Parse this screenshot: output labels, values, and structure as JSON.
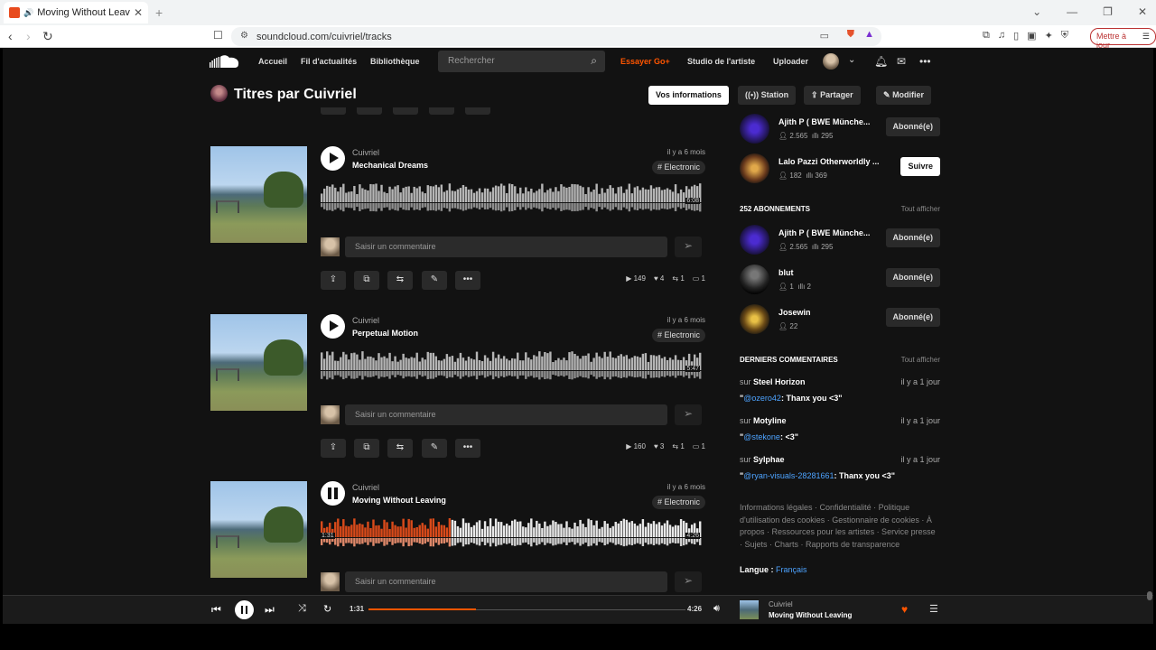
{
  "browser": {
    "tab_title": "Moving Without Leaving par",
    "url": "soundcloud.com/cuivriel/tracks",
    "update_label": "Mettre à jour"
  },
  "header": {
    "nav": [
      "Accueil",
      "Fil d'actualités",
      "Bibliothèque"
    ],
    "search_placeholder": "Rechercher",
    "go_label": "Essayer Go+",
    "studio_label": "Studio de l'artiste",
    "upload_label": "Uploader"
  },
  "title_bar": {
    "title": "Titres par Cuivriel",
    "buttons": {
      "info": "Vos informations",
      "station": "Station",
      "share": "Partager",
      "edit": "Modifier"
    }
  },
  "tracks": [
    {
      "artist": "Cuivriel",
      "title": "Mechanical Dreams",
      "ago": "il y a 6 mois",
      "tag": "# Electronic",
      "duration": "6:08",
      "comment_placeholder": "Saisir un commentaire",
      "plays": "149",
      "likes": "4",
      "reposts": "1",
      "comments": "1",
      "playing": false
    },
    {
      "artist": "Cuivriel",
      "title": "Perpetual Motion",
      "ago": "il y a 6 mois",
      "tag": "# Electronic",
      "duration": "5:47",
      "comment_placeholder": "Saisir un commentaire",
      "plays": "160",
      "likes": "3",
      "reposts": "1",
      "comments": "1",
      "playing": false
    },
    {
      "artist": "Cuivriel",
      "title": "Moving Without Leaving",
      "ago": "il y a 6 mois",
      "tag": "# Electronic",
      "position": "1:31",
      "duration": "4:26",
      "comment_placeholder": "Saisir un commentaire",
      "playing": true,
      "progress": 0.34
    }
  ],
  "sidebar": {
    "top_users": [
      {
        "name": "Ajith P ( BWE Münche...",
        "followers": "2.565",
        "tracks": "295",
        "button": "Abonné(e)"
      },
      {
        "name": "Lalo Pazzi Otherworldly ...",
        "followers": "182",
        "tracks": "369",
        "button": "Suivre"
      }
    ],
    "following_header": "252 ABONNEMENTS",
    "see_all": "Tout afficher",
    "following": [
      {
        "name": "Ajith P ( BWE Münche...",
        "followers": "2.565",
        "tracks": "295",
        "button": "Abonné(e)"
      },
      {
        "name": "blut",
        "followers": "1",
        "tracks": "2",
        "button": "Abonné(e)"
      },
      {
        "name": "Josewin",
        "followers": "22",
        "button": "Abonné(e)"
      }
    ],
    "comments_header": "DERNIERS COMMENTAIRES",
    "comments": [
      {
        "on": "sur",
        "track": "Steel Horizon",
        "time": "il y a 1 jour",
        "mention": "@ozero42",
        "text": ": Thanx you <3"
      },
      {
        "on": "sur",
        "track": "Motyline",
        "time": "il y a 1 jour",
        "mention": "@stekone",
        "text": ": <3"
      },
      {
        "on": "sur",
        "track": "Sylphae",
        "time": "il y a 1 jour",
        "mention": "@ryan-visuals-28281661",
        "text": ": Thanx you <3"
      }
    ],
    "legal": "Informations légales · Confidentialité · Politique d'utilisation des cookies · Gestionnaire de cookies · À propos · Ressources pour les artistes · Service presse · Sujets · Charts · Rapports de transparence",
    "language_label": "Langue :",
    "language": "Français"
  },
  "player": {
    "elapsed": "1:31",
    "total": "4:26",
    "progress": 0.34,
    "artist": "Cuivriel",
    "title": "Moving Without Leaving"
  },
  "colors": {
    "accent": "#ff5500",
    "background": "#121212",
    "link": "#4da3ff"
  }
}
